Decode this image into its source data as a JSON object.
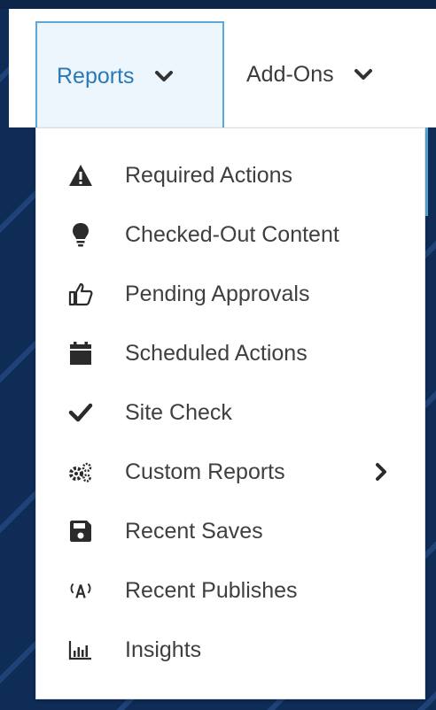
{
  "nav": {
    "tabs": [
      {
        "label": "Reports",
        "icon": "chevron-down-icon",
        "active": true
      },
      {
        "label": "Add-Ons",
        "icon": "chevron-down-icon",
        "active": false
      }
    ]
  },
  "reports_menu": {
    "items": [
      {
        "label": "Required Actions",
        "icon": "warning-icon"
      },
      {
        "label": "Checked-Out Content",
        "icon": "lightbulb-icon"
      },
      {
        "label": "Pending Approvals",
        "icon": "thumbs-up-icon"
      },
      {
        "label": "Scheduled Actions",
        "icon": "calendar-icon"
      },
      {
        "label": "Site Check",
        "icon": "checkmark-icon"
      },
      {
        "label": "Custom Reports",
        "icon": "cogs-icon",
        "submenu": true
      },
      {
        "label": "Recent Saves",
        "icon": "floppy-disk-icon"
      },
      {
        "label": "Recent Publishes",
        "icon": "broadcast-icon"
      },
      {
        "label": "Insights",
        "icon": "bar-chart-icon"
      }
    ]
  },
  "colors": {
    "background": "#0f2c57",
    "active_tab_text": "#2a79b6",
    "active_tab_border": "#5aa9d6",
    "menu_text": "#3f3f3f"
  }
}
